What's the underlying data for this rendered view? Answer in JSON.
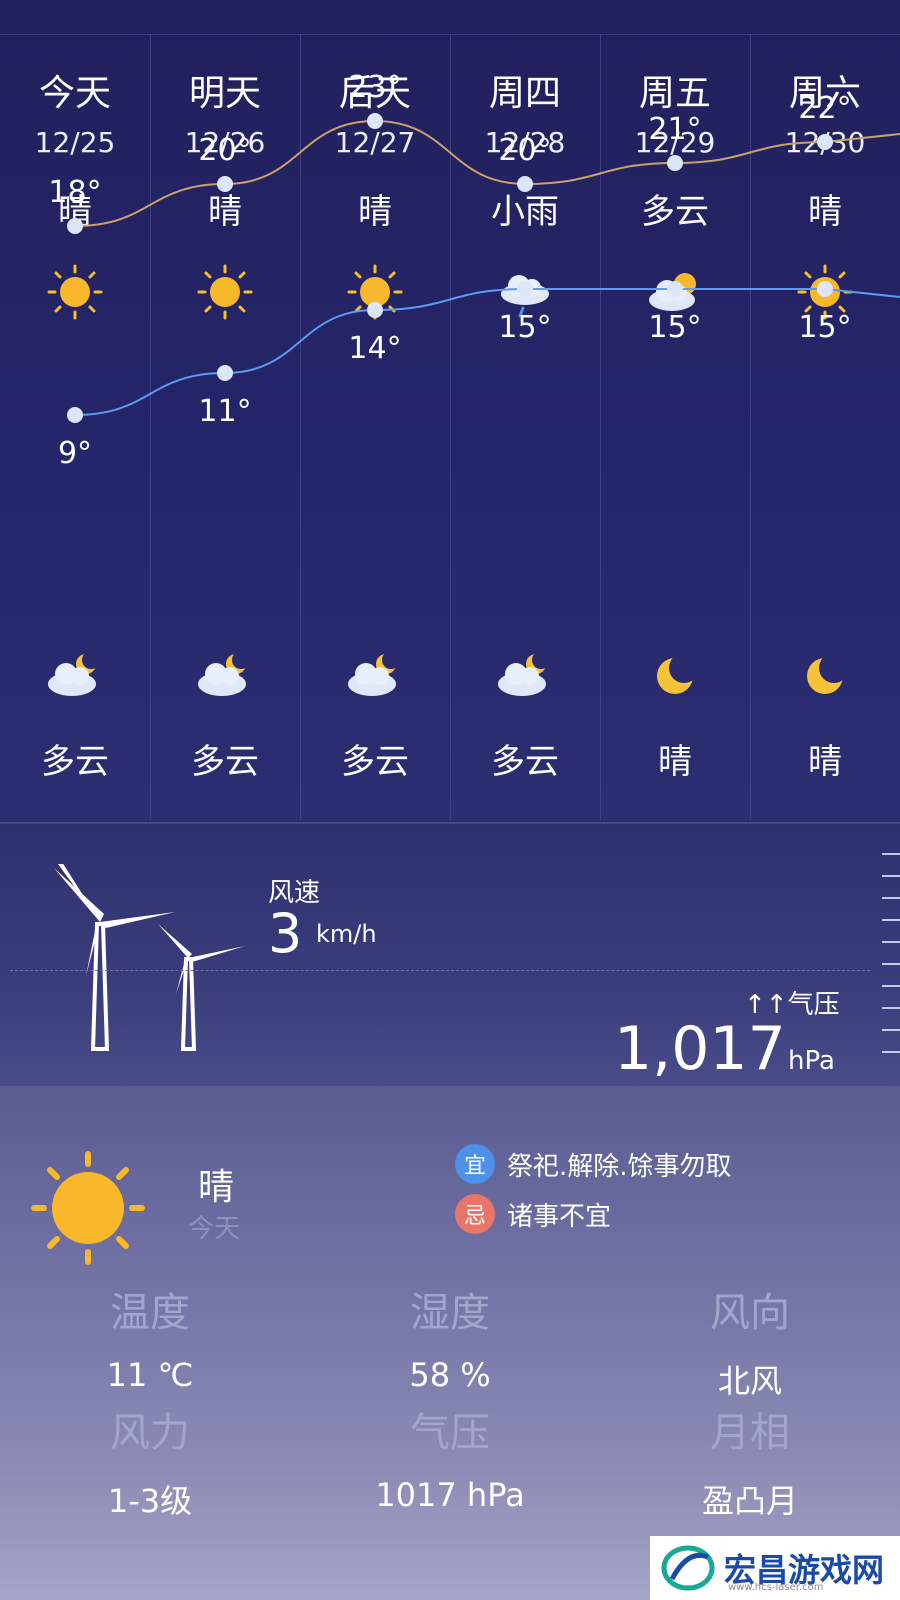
{
  "forecast": {
    "days": [
      {
        "name": "今天",
        "date": "12/25",
        "day_condition": "晴",
        "day_icon": "sun-icon",
        "high": "18°",
        "low": "9°",
        "night_icon": "cloud-moon-icon",
        "night_condition": "多云"
      },
      {
        "name": "明天",
        "date": "12/26",
        "day_condition": "晴",
        "day_icon": "sun-icon",
        "high": "20°",
        "low": "11°",
        "night_icon": "cloud-moon-icon",
        "night_condition": "多云"
      },
      {
        "name": "后天",
        "date": "12/27",
        "day_condition": "晴",
        "day_icon": "sun-icon",
        "high": "23°",
        "low": "14°",
        "night_icon": "cloud-moon-icon",
        "night_condition": "多云"
      },
      {
        "name": "周四",
        "date": "12/28",
        "day_condition": "小雨",
        "day_icon": "rain-cloud-icon",
        "high": "20°",
        "low": "15°",
        "night_icon": "cloud-moon-icon",
        "night_condition": "多云"
      },
      {
        "name": "周五",
        "date": "12/29",
        "day_condition": "多云",
        "day_icon": "cloud-sun-icon",
        "high": "21°",
        "low": "15°",
        "night_icon": "moon-icon",
        "night_condition": "晴"
      },
      {
        "name": "周六",
        "date": "12/30",
        "day_condition": "晴",
        "day_icon": "sun-icon",
        "high": "22°",
        "low": "15°",
        "night_icon": "moon-icon",
        "night_condition": "晴"
      }
    ],
    "high_values": [
      18,
      20,
      23,
      20,
      21,
      22
    ],
    "low_values": [
      9,
      11,
      14,
      15,
      15,
      15
    ],
    "high_line_color": "#c9a06a",
    "low_line_color": "#5b9af0"
  },
  "wind": {
    "label": "风速",
    "value": "3",
    "unit": "km/h"
  },
  "pressure": {
    "label": "气压",
    "arrows": "↑↑",
    "value": "1,017",
    "unit": "hPa"
  },
  "today": {
    "condition": "晴",
    "day": "今天",
    "good_badge": "宜",
    "good_text": "祭祀.解除.馀事勿取",
    "bad_badge": "忌",
    "bad_text": "诸事不宜",
    "stats": [
      {
        "label": "温度",
        "value": "11 ℃"
      },
      {
        "label": "湿度",
        "value": "58 %"
      },
      {
        "label": "风向",
        "value": "北风"
      },
      {
        "label": "风力",
        "value": "1-3级"
      },
      {
        "label": "气压",
        "value": "1017 hPa"
      },
      {
        "label": "月相",
        "value": "盈凸月"
      }
    ]
  },
  "watermark": {
    "text": "宏昌游戏网",
    "url": "www.hcs-laser.com"
  }
}
